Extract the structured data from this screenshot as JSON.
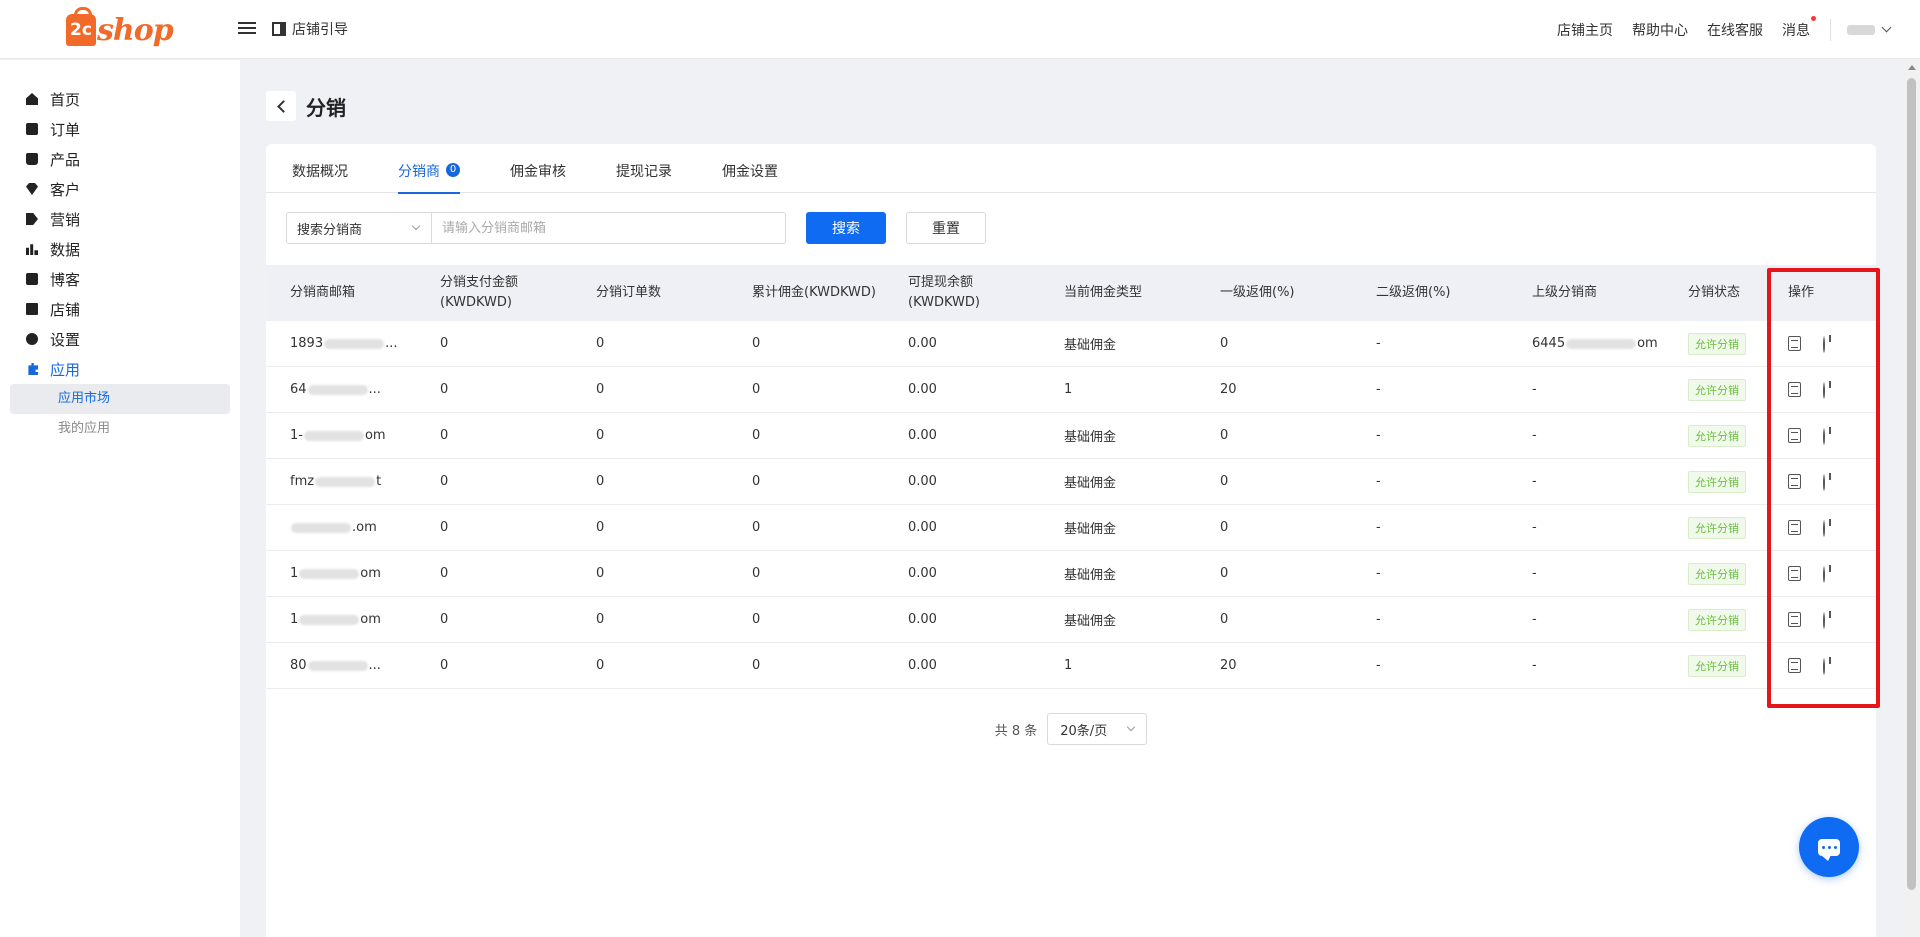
{
  "brand": {
    "logo_mark": "2c",
    "logo_text": "shop"
  },
  "topbar": {
    "guide_label": "店铺引导",
    "links": [
      "店铺主页",
      "帮助中心",
      "在线客服",
      "消息"
    ]
  },
  "sidebar": {
    "items": [
      {
        "label": "首页",
        "icon": "home-icon"
      },
      {
        "label": "订单",
        "icon": "order-icon"
      },
      {
        "label": "产品",
        "icon": "product-icon"
      },
      {
        "label": "客户",
        "icon": "customer-icon"
      },
      {
        "label": "营销",
        "icon": "marketing-icon"
      },
      {
        "label": "数据",
        "icon": "data-icon"
      },
      {
        "label": "博客",
        "icon": "blog-icon"
      },
      {
        "label": "店铺",
        "icon": "store-icon"
      },
      {
        "label": "设置",
        "icon": "settings-icon"
      },
      {
        "label": "应用",
        "icon": "apps-icon"
      }
    ],
    "subitems": [
      "应用市场",
      "我的应用"
    ]
  },
  "page": {
    "title": "分销"
  },
  "tabs": [
    {
      "label": "数据概况"
    },
    {
      "label": "分销商",
      "badge": "0"
    },
    {
      "label": "佣金审核"
    },
    {
      "label": "提现记录"
    },
    {
      "label": "佣金设置"
    }
  ],
  "filter": {
    "select_value": "搜索分销商",
    "placeholder": "请输入分销商邮箱",
    "search_label": "搜索",
    "reset_label": "重置"
  },
  "table": {
    "headers": [
      "分销商邮箱",
      "分销支付金额(KWDKWD)",
      "分销订单数",
      "累计佣金(KWDKWD)",
      "可提现余额(KWDKWD)",
      "当前佣金类型",
      "一级返佣(%)",
      "二级返佣(%)",
      "上级分销商",
      "分销状态",
      "操作"
    ],
    "rows": [
      {
        "email_a": "1893",
        "email_b": "...",
        "pay": "0",
        "orders": "0",
        "commission": "0",
        "balance": "0.00",
        "type": "基础佣金",
        "l1": "0",
        "l2": "-",
        "parent": "6445",
        "parent_b": "om",
        "status": "允许分销"
      },
      {
        "email_a": "64",
        "email_b": "...",
        "pay": "0",
        "orders": "0",
        "commission": "0",
        "balance": "0.00",
        "type": "1",
        "l1": "20",
        "l2": "-",
        "parent": "-",
        "parent_b": "",
        "status": "允许分销"
      },
      {
        "email_a": "1-",
        "email_b": "om",
        "pay": "0",
        "orders": "0",
        "commission": "0",
        "balance": "0.00",
        "type": "基础佣金",
        "l1": "0",
        "l2": "-",
        "parent": "-",
        "parent_b": "",
        "status": "允许分销"
      },
      {
        "email_a": "fmz",
        "email_b": "t",
        "pay": "0",
        "orders": "0",
        "commission": "0",
        "balance": "0.00",
        "type": "基础佣金",
        "l1": "0",
        "l2": "-",
        "parent": "-",
        "parent_b": "",
        "status": "允许分销"
      },
      {
        "email_a": "",
        "email_b": ".om",
        "pay": "0",
        "orders": "0",
        "commission": "0",
        "balance": "0.00",
        "type": "基础佣金",
        "l1": "0",
        "l2": "-",
        "parent": "-",
        "parent_b": "",
        "status": "允许分销"
      },
      {
        "email_a": "1",
        "email_b": "om",
        "pay": "0",
        "orders": "0",
        "commission": "0",
        "balance": "0.00",
        "type": "基础佣金",
        "l1": "0",
        "l2": "-",
        "parent": "-",
        "parent_b": "",
        "status": "允许分销"
      },
      {
        "email_a": "1",
        "email_b": "om",
        "pay": "0",
        "orders": "0",
        "commission": "0",
        "balance": "0.00",
        "type": "基础佣金",
        "l1": "0",
        "l2": "-",
        "parent": "-",
        "parent_b": "",
        "status": "允许分销"
      },
      {
        "email_a": "80",
        "email_b": "...",
        "pay": "0",
        "orders": "0",
        "commission": "0",
        "balance": "0.00",
        "type": "1",
        "l1": "20",
        "l2": "-",
        "parent": "-",
        "parent_b": "",
        "status": "允许分销"
      }
    ]
  },
  "pagination": {
    "total": "共 8 条",
    "page_size": "20条/页"
  },
  "colors": {
    "primary": "#0f6bf2",
    "accent_orange": "#f26a2a",
    "highlight": "#e5161b",
    "status_green": "#6abf3e"
  }
}
